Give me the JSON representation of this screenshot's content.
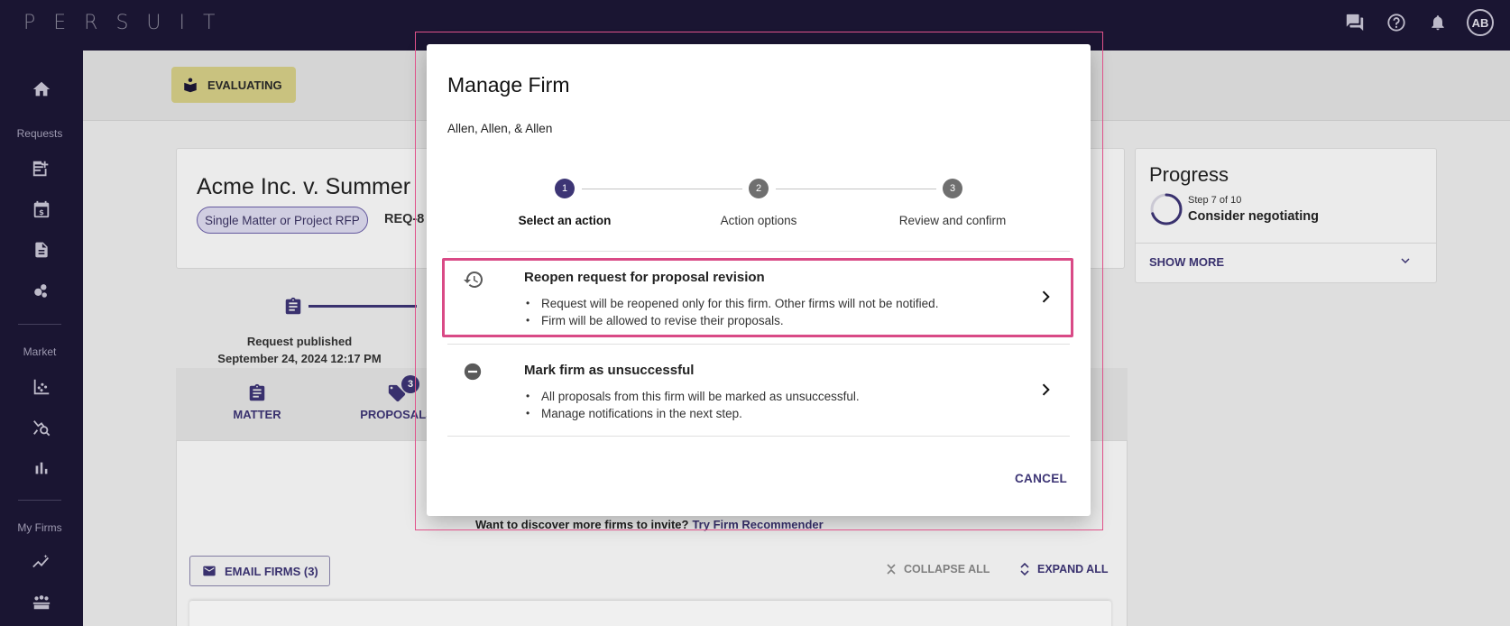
{
  "app": {
    "logo": "PERSUIT",
    "avatar_initials": "AB"
  },
  "sidebar": {
    "sections": [
      {
        "label": "Requests"
      },
      {
        "label": "Market"
      },
      {
        "label": "My Firms"
      }
    ]
  },
  "request": {
    "status": "EVALUATING",
    "title": "Acme Inc. v. Summer",
    "type_chip": "Single Matter or Project RFP",
    "req_id": "REQ-8",
    "timeline": {
      "label": "Request published",
      "date": "September 24, 2024 12:17 PM"
    }
  },
  "tabs": [
    {
      "label": "MATTER"
    },
    {
      "label": "PROPOSALS",
      "badge": "3"
    }
  ],
  "content": {
    "discover_text": "Want to discover more firms to invite?",
    "discover_link": "Try Firm Recommender",
    "email_firms_label": "EMAIL FIRMS (3)",
    "collapse_all_label": "COLLAPSE ALL",
    "expand_all_label": "EXPAND ALL"
  },
  "progress": {
    "title": "Progress",
    "step_text": "Step 7 of 10",
    "step_fraction": 0.7,
    "step_name": "Consider negotiating",
    "show_more_label": "SHOW MORE"
  },
  "modal": {
    "title": "Manage Firm",
    "firm_name": "Allen, Allen, & Allen",
    "steps": [
      {
        "number": "1",
        "label": "Select an action",
        "active": true
      },
      {
        "number": "2",
        "label": "Action options",
        "active": false
      },
      {
        "number": "3",
        "label": "Review and confirm",
        "active": false
      }
    ],
    "options": [
      {
        "title": "Reopen request for proposal revision",
        "icon": "history-icon",
        "bullets": [
          "Request will be reopened only for this firm. Other firms will not be notified.",
          "Firm will be allowed to revise their proposals."
        ]
      },
      {
        "title": "Mark firm as unsuccessful",
        "icon": "minus-circle-icon",
        "bullets": [
          "All proposals from this firm will be marked as unsuccessful.",
          "Manage notifications in the next step."
        ]
      }
    ],
    "cancel_label": "CANCEL"
  },
  "colors": {
    "nav_bg": "#1c1736",
    "accent": "#3d3575",
    "highlight": "#d94a86",
    "status_badge": "#d6cf87"
  }
}
